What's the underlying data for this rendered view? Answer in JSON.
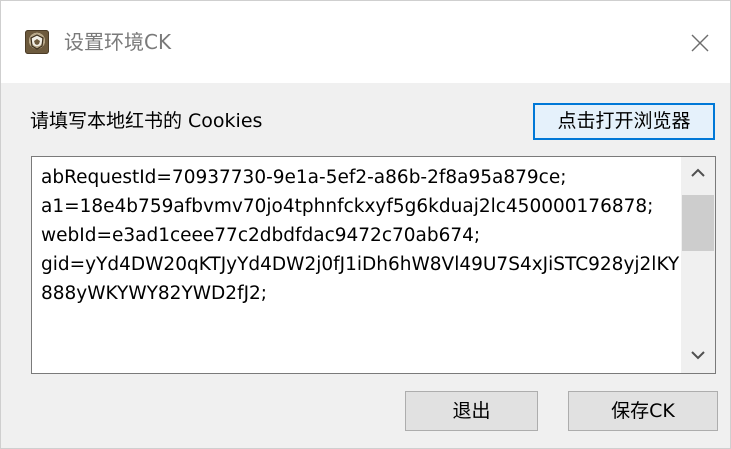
{
  "window": {
    "title": "设置环境CK",
    "app_icon": "app-emblem-icon",
    "close_icon": "close-icon"
  },
  "content": {
    "prompt_label": "请填写本地红书的 Cookies",
    "open_browser_label": "点击打开浏览器",
    "cookie_value": "abRequestId=70937730-9e1a-5ef2-a86b-2f8a95a879ce;\na1=18e4b759afbvmv70jo4tphnfckxyf5g6kduaj2lc450000176878;\nwebId=e3ad1ceee77c2dbdfdac9472c70ab674;\ngid=yYd4DW20qKTJyYd4DW2j0fJ1iDh6hW8Vl49U7S4xJiSTC928yj2lKY888yWKYWY82YWD2fJ2;",
    "scroll_up_icon": "chevron-up-icon",
    "scroll_down_icon": "chevron-down-icon"
  },
  "buttons": {
    "exit_label": "退出",
    "save_label": "保存CK"
  },
  "colors": {
    "focus_border": "#0078d7",
    "dialog_background": "#f0f0f0",
    "button_background": "#e1e1e1"
  }
}
